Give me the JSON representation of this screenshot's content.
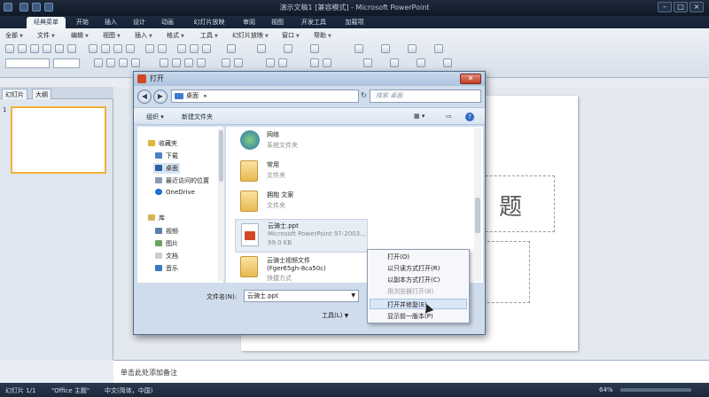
{
  "window": {
    "title": "演示文稿1 [兼容模式] - Microsoft PowerPoint"
  },
  "ribbon_tabs": [
    "经典菜单",
    "开始",
    "插入",
    "设计",
    "动画",
    "幻灯片放映",
    "审阅",
    "视图",
    "开发工具",
    "加载项"
  ],
  "classic_menus": [
    "全部",
    "文件",
    "编辑",
    "视图",
    "插入",
    "格式",
    "工具",
    "幻灯片放映",
    "窗口",
    "帮助"
  ],
  "left_pane": {
    "tabs": [
      "幻灯片",
      "大纲"
    ],
    "slide_number": "1"
  },
  "slide": {
    "title_fragment": "题"
  },
  "notes": {
    "placeholder": "单击此处添加备注"
  },
  "status": {
    "slide": "幻灯片 1/1",
    "theme": "\"Office 主题\"",
    "language": "中文(简体，中国)",
    "zoom": "64%"
  },
  "dialog": {
    "title": "打开",
    "address": "桌面",
    "search_placeholder": "搜索 桌面",
    "commands": {
      "organize": "组织",
      "new_folder": "新建文件夹"
    },
    "nav": {
      "favorites_header": "收藏夹",
      "favorites": [
        "下载",
        "桌面",
        "最近访问的位置",
        "OneDrive"
      ],
      "libraries_header": "库",
      "libraries": [
        "视频",
        "图片",
        "文档",
        "音乐"
      ]
    },
    "files": [
      {
        "name": "网络",
        "sub": "系统文件夹"
      },
      {
        "name": "常用",
        "sub": "文件夹"
      },
      {
        "name": "拥抱 文案",
        "sub": "文件夹"
      },
      {
        "name": "云骑士.ppt",
        "sub": "Microsoft PowerPoint 97-2003...",
        "sub2": "99.0 KB"
      },
      {
        "name": "云骑士视频文件",
        "sub": "(Fger65gh-8ca50c)",
        "sub2": "快捷方式"
      }
    ],
    "filename_label": "文件名(N):",
    "filename_value": "云骑士.ppt",
    "tools_label": "工具(L)"
  },
  "open_menu": {
    "items": [
      "打开(O)",
      "以只读方式打开(R)",
      "以副本方式打开(C)",
      "用浏览器打开(B)",
      "打开并修复(E)",
      "显示前一版本(P)"
    ],
    "highlighted_index": 4
  }
}
